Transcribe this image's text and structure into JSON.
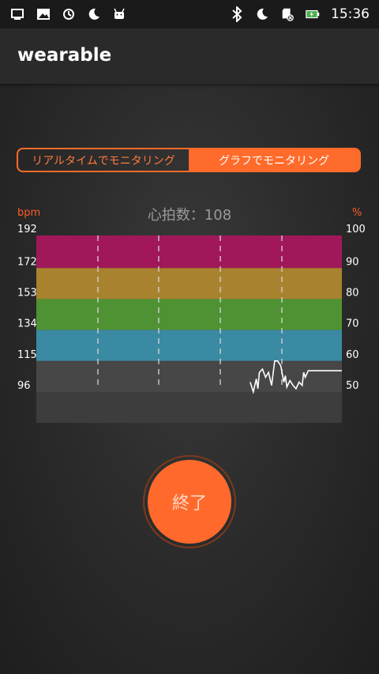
{
  "status_bar": {
    "time": "15:36",
    "left_icons": [
      "usb-debug-icon",
      "image-icon",
      "sync-icon",
      "moon-icon",
      "android-icon"
    ],
    "right_icons": [
      "bluetooth-icon",
      "moon-icon",
      "sd-card-icon",
      "battery-charging-icon"
    ]
  },
  "app_bar": {
    "title": "wearable"
  },
  "tabs": [
    {
      "label": "リアルタイムでモニタリング",
      "active": false
    },
    {
      "label": "グラフでモニタリング",
      "active": true
    }
  ],
  "heart_rate": {
    "label": "心拍数：108"
  },
  "chart_data": {
    "type": "line",
    "title": "",
    "ylabel_left": "bpm",
    "ylabel_right": "%",
    "y_left_ticks": [
      "192",
      "172",
      "153",
      "134",
      "115",
      "96"
    ],
    "y_right_ticks": [
      "100",
      "90",
      "80",
      "70",
      "60",
      "50"
    ],
    "zones": [
      {
        "from": 172,
        "to": 192,
        "color": "#a0185a"
      },
      {
        "from": 153,
        "to": 172,
        "color": "#a8822e"
      },
      {
        "from": 134,
        "to": 153,
        "color": "#4f9233"
      },
      {
        "from": 115,
        "to": 134,
        "color": "#3a8aa3"
      },
      {
        "from": 96,
        "to": 115,
        "color": "#474747"
      }
    ],
    "ylim": [
      77,
      192
    ],
    "series": [
      {
        "color": "#ffffff",
        "points": [
          [
            0.7,
            102
          ],
          [
            0.71,
            96
          ],
          [
            0.72,
            104
          ],
          [
            0.725,
            98
          ],
          [
            0.73,
            108
          ],
          [
            0.74,
            110
          ],
          [
            0.75,
            105
          ],
          [
            0.76,
            108
          ],
          [
            0.77,
            100
          ],
          [
            0.78,
            115
          ],
          [
            0.79,
            115
          ],
          [
            0.8,
            112
          ],
          [
            0.81,
            102
          ],
          [
            0.815,
            106
          ],
          [
            0.82,
            99
          ],
          [
            0.83,
            103
          ],
          [
            0.84,
            100
          ],
          [
            0.85,
            98
          ],
          [
            0.86,
            102
          ],
          [
            0.87,
            100
          ],
          [
            0.875,
            108
          ],
          [
            0.88,
            105
          ],
          [
            0.89,
            109
          ],
          [
            0.9,
            109
          ],
          [
            0.95,
            109
          ],
          [
            1.0,
            109
          ]
        ]
      }
    ],
    "grid": "vertical-dashed"
  },
  "stop_button": {
    "label": "終了"
  },
  "colors": {
    "accent": "#ff6b2b",
    "axis_label": "#ff5a2a"
  }
}
